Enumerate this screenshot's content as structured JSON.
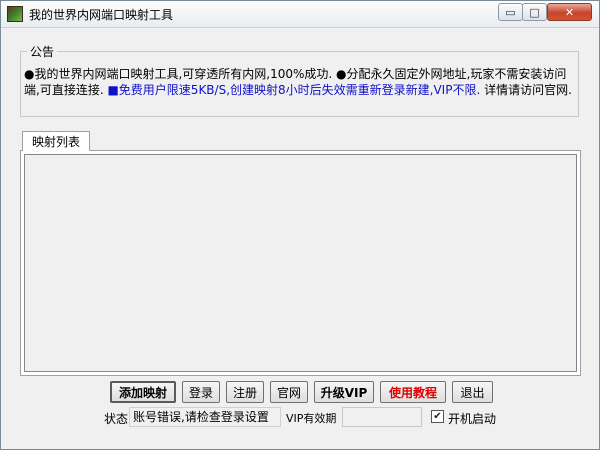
{
  "window": {
    "title": "我的世界内网端口映射工具",
    "icon": "minecraft-grass-block-icon",
    "controls": {
      "minimize": "▭",
      "maximize": "□",
      "close": "✕"
    }
  },
  "notice": {
    "legend": "公告",
    "part1": "●我的世界内网端口映射工具,可穿透所有内网,100%成功. ●分配永久固定外网地址,玩家不需安装访问端,可直接连接.",
    "highlight": "■免费用户限速5KB/S,创建映射8小时后失效需重新登录新建,VIP不限.",
    "part2": "详情请访问官网.",
    "highlight_color": "#1010c8"
  },
  "tabs": [
    {
      "label": "映射列表"
    }
  ],
  "buttons": {
    "add_mapping": "添加映射",
    "login": "登录",
    "register": "注册",
    "official_site": "官网",
    "upgrade_vip": "升级VIP",
    "tutorial": "使用教程",
    "exit": "退出"
  },
  "status": {
    "label": "状态",
    "value": "账号错误,请检查登录设置",
    "vip_label": "VIP有效期",
    "vip_value": ""
  },
  "autostart": {
    "label": "开机启动",
    "checked": true,
    "mark": "✔"
  },
  "colors": {
    "tutorial_text": "#e00000",
    "close_button": "#c8442c"
  }
}
